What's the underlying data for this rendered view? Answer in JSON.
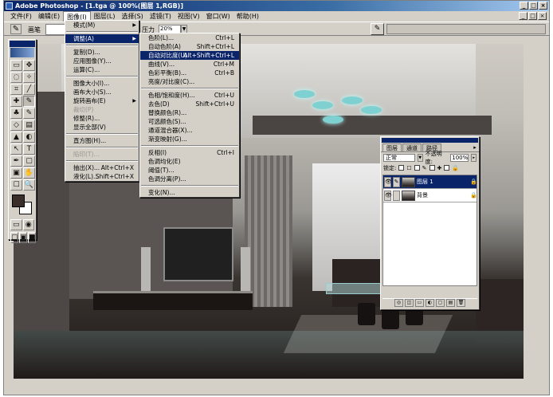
{
  "window": {
    "title": "Adobe Photoshop - [1.tga @ 100%(图层 1,RGB)]",
    "buttons": [
      "_",
      "□",
      "×"
    ]
  },
  "menubar": {
    "items": [
      "文件(F)",
      "编辑(E)",
      "图像(I)",
      "图层(L)",
      "选择(S)",
      "滤镜(T)",
      "视图(V)",
      "窗口(W)",
      "帮助(H)"
    ],
    "open_index": 2
  },
  "options": {
    "tool_label": "画笔",
    "pressure_label": "压力",
    "pressure_value": "20%",
    "dropdown_arrow": "▼"
  },
  "image_menu": [
    {
      "label": "模式(M)",
      "submenu": true
    },
    {
      "sep": true
    },
    {
      "label": "调整(A)",
      "submenu": true,
      "highlight": true
    },
    {
      "sep": true
    },
    {
      "label": "复制(D)..."
    },
    {
      "label": "应用图像(Y)..."
    },
    {
      "label": "运算(C)..."
    },
    {
      "sep": true
    },
    {
      "label": "图像大小(I)..."
    },
    {
      "label": "画布大小(S)..."
    },
    {
      "label": "旋转画布(E)",
      "submenu": true
    },
    {
      "label": "裁切(P)",
      "disabled": true
    },
    {
      "label": "修整(R)..."
    },
    {
      "label": "显示全部(V)"
    },
    {
      "sep": true
    },
    {
      "label": "直方图(H)..."
    },
    {
      "sep": true
    },
    {
      "label": "陷印(T)...",
      "disabled": true
    },
    {
      "sep": true
    },
    {
      "label": "抽出(X)...",
      "shortcut": "Alt+Ctrl+X"
    },
    {
      "label": "液化(L)...",
      "shortcut": "Shift+Ctrl+X"
    }
  ],
  "adjust_menu": [
    {
      "label": "色阶(L)...",
      "shortcut": "Ctrl+L"
    },
    {
      "label": "自动色阶(A)",
      "shortcut": "Shift+Ctrl+L"
    },
    {
      "label": "自动对比度(U)",
      "shortcut": "Alt+Shift+Ctrl+L",
      "highlight": true
    },
    {
      "label": "曲线(V)...",
      "shortcut": "Ctrl+M"
    },
    {
      "label": "色彩平衡(B)...",
      "shortcut": "Ctrl+B"
    },
    {
      "label": "亮度/对比度(C)..."
    },
    {
      "sep": true
    },
    {
      "label": "色相/饱和度(H)...",
      "shortcut": "Ctrl+U"
    },
    {
      "label": "去色(D)",
      "shortcut": "Shift+Ctrl+U"
    },
    {
      "label": "替换颜色(R)..."
    },
    {
      "label": "可选颜色(S)..."
    },
    {
      "label": "通道混合器(X)..."
    },
    {
      "label": "渐变映射(G)..."
    },
    {
      "sep": true
    },
    {
      "label": "反相(I)",
      "shortcut": "Ctrl+I"
    },
    {
      "label": "色调均化(E)"
    },
    {
      "label": "阈值(T)..."
    },
    {
      "label": "色调分离(P)..."
    },
    {
      "sep": true
    },
    {
      "label": "变化(N)..."
    }
  ],
  "toolbox": {
    "tools": [
      "▭",
      "✥",
      "◌",
      "✧",
      "⌗",
      "╱",
      "✚",
      "✎",
      "♣",
      "✎",
      "◇",
      "▤",
      "▲",
      "◐",
      "↖",
      "T",
      "✒",
      "▢",
      "▣",
      "✋",
      "☐",
      "🔍"
    ],
    "selected_index": 7,
    "modes": [
      "▭",
      "◉"
    ],
    "screens": [
      "▢",
      "▣",
      "■"
    ]
  },
  "layers_panel": {
    "tabs": [
      "图层",
      "通道",
      "路径"
    ],
    "tab_menu": "▸",
    "blend_mode": "正常",
    "opacity_label": "不透明度:",
    "opacity_value": "100%",
    "lock_label": "锁定:",
    "lock_icons": [
      "☐",
      "✎",
      "✚",
      "🔒"
    ],
    "layers": [
      {
        "name": "图层 1",
        "active": true,
        "eye": "👁",
        "brush": "✎",
        "lock": "🔒"
      },
      {
        "name": "背景",
        "active": false,
        "eye": "👁",
        "brush": "",
        "lock": "🔒"
      }
    ],
    "footer": [
      "◎",
      "◫",
      "▭",
      "◐",
      "▢",
      "▤",
      "🗑"
    ]
  }
}
